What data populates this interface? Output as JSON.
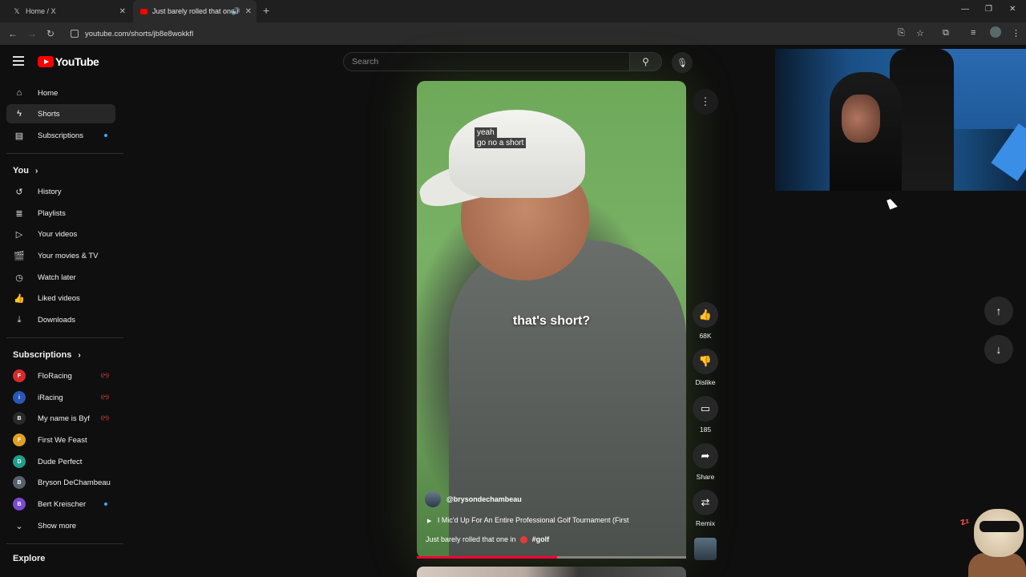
{
  "browser": {
    "tabs": [
      {
        "title": "Home / X",
        "icon": "x-logo-icon"
      },
      {
        "title": "Just barely rolled that one i",
        "icon": "youtube-favicon"
      }
    ],
    "url": "youtube.com/shorts/jb8e8wokkfl"
  },
  "youtube": {
    "logo_text": "YouTube",
    "search_placeholder": "Search"
  },
  "sidebar": {
    "main": [
      {
        "label": "Home",
        "icon": "home-icon"
      },
      {
        "label": "Shorts",
        "icon": "shorts-icon",
        "active": true
      },
      {
        "label": "Subscriptions",
        "icon": "subscriptions-icon"
      }
    ],
    "you_heading": "You",
    "you": [
      {
        "label": "History",
        "icon": "history-icon"
      },
      {
        "label": "Playlists",
        "icon": "playlists-icon"
      },
      {
        "label": "Your videos",
        "icon": "your-videos-icon"
      },
      {
        "label": "Your movies & TV",
        "icon": "movies-icon"
      },
      {
        "label": "Watch later",
        "icon": "watch-later-icon"
      },
      {
        "label": "Liked videos",
        "icon": "liked-videos-icon"
      },
      {
        "label": "Downloads",
        "icon": "downloads-icon"
      }
    ],
    "subs_heading": "Subscriptions",
    "subscriptions": [
      {
        "label": "FloRacing",
        "color": "#d62b2b",
        "status": "live"
      },
      {
        "label": "iRacing",
        "color": "#2a56b8",
        "status": "live"
      },
      {
        "label": "My name is Byf",
        "color": "#2a2a2a",
        "status": "live"
      },
      {
        "label": "First We Feast",
        "color": "#e0a020",
        "status": "none"
      },
      {
        "label": "Dude Perfect",
        "color": "#1ea08a",
        "status": "none"
      },
      {
        "label": "Bryson DeChambeau",
        "color": "#56606a",
        "status": "none"
      },
      {
        "label": "Bert Kreischer",
        "color": "#7a4ad0",
        "status": "new"
      }
    ],
    "show_more": "Show more",
    "explore_heading": "Explore"
  },
  "short": {
    "subtitle_line1": "yeah",
    "subtitle_line2": "go no a short",
    "center_caption": "that's short?",
    "channel": "@brysondechambeau",
    "related_video": "I Mic'd Up For An Entire Professional Golf Tournament (First",
    "title": "Just barely rolled that one in",
    "hashtag": "#golf",
    "progress_fraction": 0.52
  },
  "actions": {
    "like_count": "68K",
    "dislike_label": "Dislike",
    "comment_count": "185",
    "share_label": "Share",
    "remix_label": "Remix"
  }
}
